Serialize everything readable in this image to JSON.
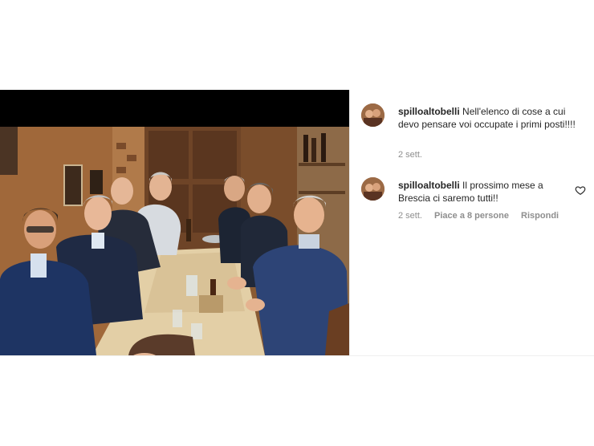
{
  "comments": [
    {
      "username": "spilloaltobelli",
      "text": "Nell'elenco di cose a cui devo pensare voi occupate i primi posti!!!!",
      "time": "2 sett."
    },
    {
      "username": "spilloaltobelli",
      "text": "Il prossimo mese a Brescia ci saremo tutti!!",
      "time": "2 sett.",
      "likes": "Piace a 8 persone",
      "reply": "Rispondi",
      "heart_icon": "heart-outline-icon"
    }
  ],
  "colors": {
    "text": "#262626",
    "muted": "#8e8e8e",
    "divider": "#efefef"
  }
}
